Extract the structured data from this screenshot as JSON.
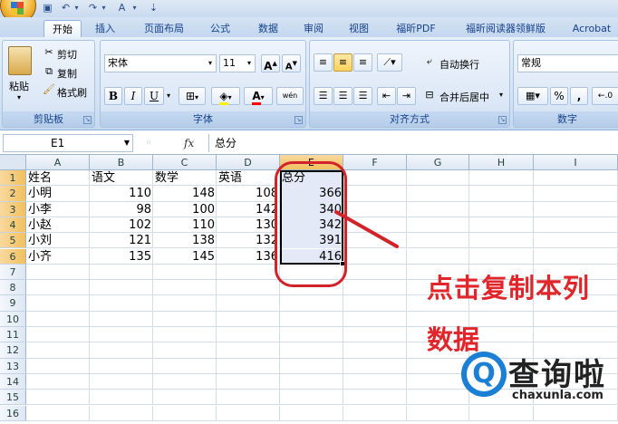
{
  "window": {
    "qat_icons": [
      "save-icon",
      "undo-icon",
      "redo-icon",
      "font-color-icon"
    ]
  },
  "tabs": [
    "开始",
    "插入",
    "页面布局",
    "公式",
    "数据",
    "审阅",
    "视图",
    "福昕PDF",
    "福昕阅读器领鲜版",
    "Acrobat"
  ],
  "ribbon": {
    "clipboard": {
      "label": "剪贴板",
      "paste": "粘贴",
      "cut": "剪切",
      "copy": "复制",
      "format_painter": "格式刷"
    },
    "font": {
      "label": "字体",
      "font_name": "宋体",
      "font_size": "11",
      "bold": "B",
      "italic": "I",
      "underline": "U",
      "grow": "A",
      "shrink": "A",
      "font_color_label": "A",
      "pinyin": "wén"
    },
    "alignment": {
      "label": "对齐方式",
      "wrap_text": "自动换行",
      "merge_center": "合并后居中"
    },
    "number": {
      "label": "数字",
      "format": "常规",
      "percent": "%",
      "comma": ","
    }
  },
  "formula_bar": {
    "name_box": "E1",
    "fx": "fx",
    "content": "总分"
  },
  "columns": [
    "A",
    "B",
    "C",
    "D",
    "E",
    "F",
    "G",
    "H",
    "I"
  ],
  "rows": [
    "1",
    "2",
    "3",
    "4",
    "5",
    "6",
    "7",
    "8",
    "9",
    "10",
    "11",
    "12",
    "13",
    "14",
    "15",
    "16"
  ],
  "table": {
    "headers": [
      "姓名",
      "语文",
      "数学",
      "英语",
      "总分"
    ],
    "rows": [
      [
        "小明",
        "110",
        "148",
        "108",
        "366"
      ],
      [
        "小李",
        "98",
        "100",
        "142",
        "340"
      ],
      [
        "小赵",
        "102",
        "110",
        "130",
        "342"
      ],
      [
        "小刘",
        "121",
        "138",
        "132",
        "391"
      ],
      [
        "小齐",
        "135",
        "145",
        "136",
        "416"
      ]
    ]
  },
  "annotation": {
    "line1": "点击复制本列",
    "line2": "数据",
    "color": "#e1262b"
  },
  "watermark": {
    "brand": "查询啦",
    "url": "chaxunla.com",
    "q": "Q"
  },
  "colors": {
    "selection_header": "#f1c15f",
    "selection_fill": "#e3e9f6",
    "ribbon_text": "#15428b"
  }
}
